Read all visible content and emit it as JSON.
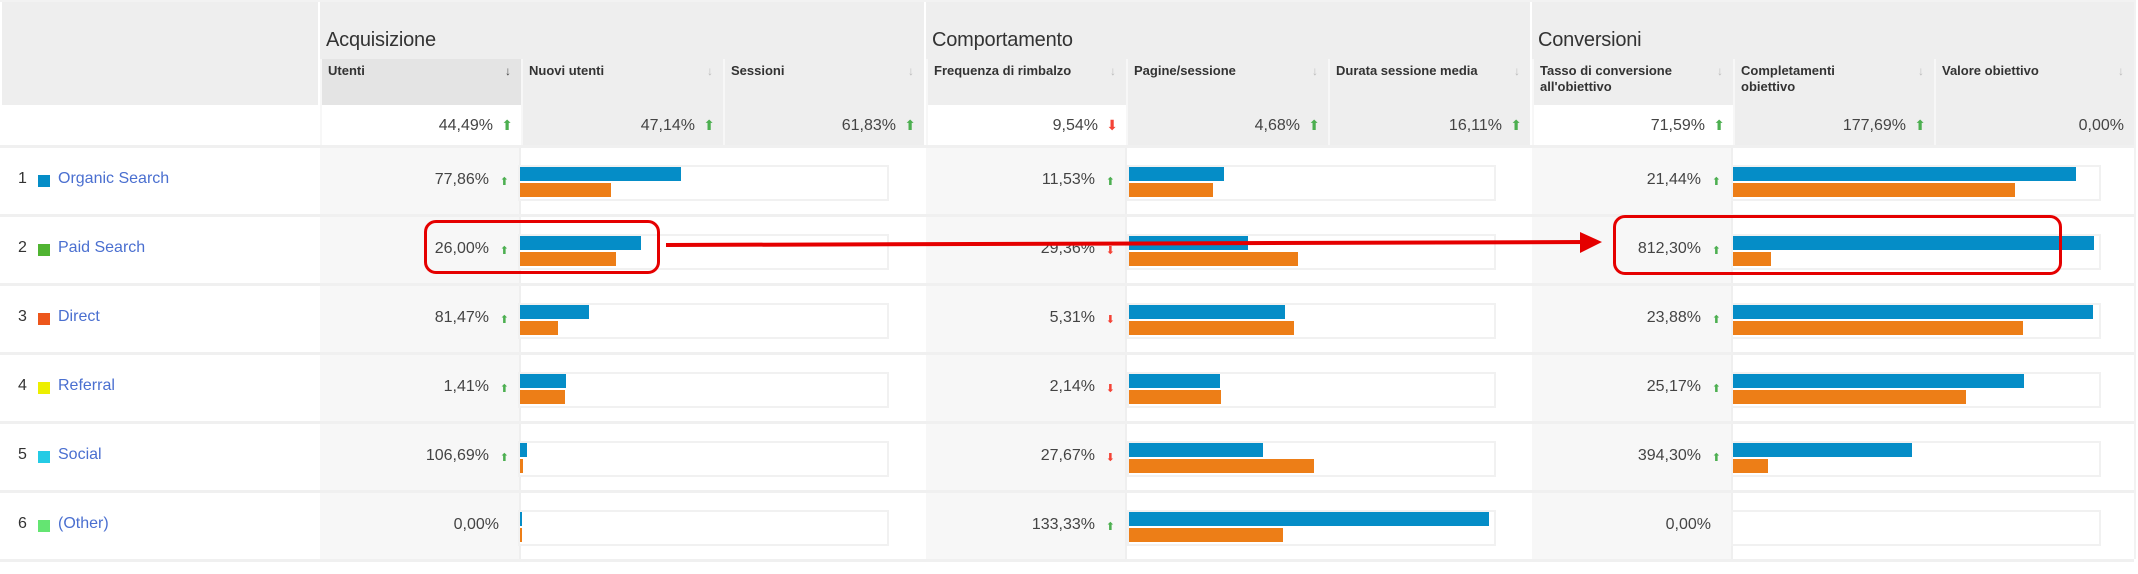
{
  "groups": [
    {
      "title": "Acquisizione"
    },
    {
      "title": "Comportamento"
    },
    {
      "title": "Conversioni"
    }
  ],
  "columns": [
    {
      "label": "Utenti",
      "sorted": true,
      "total": "44,49%",
      "total_trend": "up"
    },
    {
      "label": "Nuovi utenti",
      "sorted": false,
      "total": "47,14%",
      "total_trend": "up"
    },
    {
      "label": "Sessioni",
      "sorted": false,
      "total": "61,83%",
      "total_trend": "up"
    },
    {
      "label": "Frequenza di rimbalzo",
      "sorted": false,
      "total": "9,54%",
      "total_trend": "down"
    },
    {
      "label": "Pagine/sessione",
      "sorted": false,
      "total": "4,68%",
      "total_trend": "up"
    },
    {
      "label": "Durata sessione media",
      "sorted": false,
      "total": "16,11%",
      "total_trend": "up"
    },
    {
      "label": "Tasso di conversione all'obiettivo",
      "sorted": false,
      "total": "71,59%",
      "total_trend": "up"
    },
    {
      "label": "Completamenti obiettivo",
      "sorted": false,
      "total": "177,69%",
      "total_trend": "up"
    },
    {
      "label": "Valore obiettivo",
      "sorted": false,
      "total": "0,00%",
      "total_trend": "none"
    }
  ],
  "sort_icon": "↓",
  "rows": [
    {
      "index": "1",
      "channel": "Organic Search",
      "color": "#058dc7",
      "acq": {
        "value": "77,86%",
        "trend": "up",
        "bar_current": 0.444,
        "bar_previous": 0.25
      },
      "beh": {
        "value": "11,53%",
        "trend": "up",
        "bar_current": 0.262,
        "bar_previous": 0.232
      },
      "conv": {
        "value": "21,44%",
        "trend": "up",
        "bar_current": 0.948,
        "bar_previous": 0.779
      }
    },
    {
      "index": "2",
      "channel": "Paid Search",
      "color": "#50b432",
      "acq": {
        "value": "26,00%",
        "trend": "up",
        "bar_current": 0.332,
        "bar_previous": 0.265
      },
      "beh": {
        "value": "29,36%",
        "trend": "down",
        "bar_current": 0.33,
        "bar_previous": 0.468
      },
      "conv": {
        "value": "812,30%",
        "trend": "up",
        "bar_current": 0.996,
        "bar_previous": 0.105
      }
    },
    {
      "index": "3",
      "channel": "Direct",
      "color": "#ed561b",
      "acq": {
        "value": "81,47%",
        "trend": "up",
        "bar_current": 0.19,
        "bar_previous": 0.104
      },
      "beh": {
        "value": "5,31%",
        "trend": "down",
        "bar_current": 0.431,
        "bar_previous": 0.457
      },
      "conv": {
        "value": "23,88%",
        "trend": "up",
        "bar_current": 0.993,
        "bar_previous": 0.8
      }
    },
    {
      "index": "4",
      "channel": "Referral",
      "color": "#edef00",
      "acq": {
        "value": "1,41%",
        "trend": "up",
        "bar_current": 0.127,
        "bar_previous": 0.123
      },
      "beh": {
        "value": "2,14%",
        "trend": "down",
        "bar_current": 0.251,
        "bar_previous": 0.255
      },
      "conv": {
        "value": "25,17%",
        "trend": "up",
        "bar_current": 0.805,
        "bar_previous": 0.644
      }
    },
    {
      "index": "5",
      "channel": "Social",
      "color": "#24cbe5",
      "acq": {
        "value": "106,69%",
        "trend": "up",
        "bar_current": 0.019,
        "bar_previous": 0.007
      },
      "beh": {
        "value": "27,67%",
        "trend": "down",
        "bar_current": 0.371,
        "bar_previous": 0.513
      },
      "conv": {
        "value": "394,30%",
        "trend": "up",
        "bar_current": 0.494,
        "bar_previous": 0.097
      }
    },
    {
      "index": "6",
      "channel": "(Other)",
      "color": "#64e572",
      "acq": {
        "value": "0,00%",
        "trend": "none",
        "bar_current": 0.004,
        "bar_previous": 0.004
      },
      "beh": {
        "value": "133,33%",
        "trend": "up",
        "bar_current": 0.996,
        "bar_previous": 0.427
      },
      "conv": {
        "value": "0,00%",
        "trend": "none",
        "bar_current": 0,
        "bar_previous": 0
      }
    }
  ],
  "colors": {
    "bar_current": "#058dc7",
    "bar_previous": "#ed7e17",
    "trend_up": "#4caf50",
    "trend_down": "#f44336",
    "annotation": "#e50000"
  },
  "annotation": {
    "highlighted_row": "Paid Search",
    "from": "26,00%",
    "to": "812,30%"
  }
}
